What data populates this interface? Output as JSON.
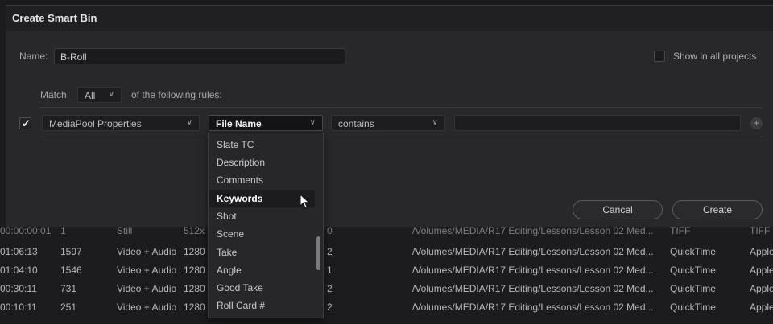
{
  "dialog": {
    "title": "Create Smart Bin",
    "name_label": "Name:",
    "name_value": "B-Roll",
    "show_all_label": "Show in all projects",
    "match_label": "Match",
    "match_value": "All",
    "match_suffix": "of the following rules:",
    "rule": {
      "property": "MediaPool Properties",
      "field": "File Name",
      "operator": "contains",
      "value": ""
    },
    "cancel_label": "Cancel",
    "create_label": "Create"
  },
  "dropdown": {
    "items": [
      "Slate TC",
      "Description",
      "Comments",
      "Keywords",
      "Shot",
      "Scene",
      "Take",
      "Angle",
      "Good Take",
      "Roll Card #"
    ],
    "highlighted": "Keywords"
  },
  "background_table": {
    "rows": [
      {
        "tc": "00:00:00:01",
        "frames": "1",
        "type": "Still",
        "res": "512x",
        "c5": "0",
        "path": "/Volumes/MEDIA/R17 Editing/Lessons/Lesson 02 Med...",
        "codec": "TIFF",
        "last": "TIFF"
      },
      {
        "tc": "01:06:13",
        "frames": "1597",
        "type": "Video + Audio",
        "res": "1280",
        "c5": "2",
        "path": "/Volumes/MEDIA/R17 Editing/Lessons/Lesson 02 Med...",
        "codec": "QuickTime",
        "last": "Apple"
      },
      {
        "tc": "01:04:10",
        "frames": "1546",
        "type": "Video + Audio",
        "res": "1280",
        "c5": "1",
        "path": "/Volumes/MEDIA/R17 Editing/Lessons/Lesson 02 Med...",
        "codec": "QuickTime",
        "last": "Apple"
      },
      {
        "tc": "00:30:11",
        "frames": "731",
        "type": "Video + Audio",
        "res": "1280",
        "c5": "2",
        "path": "/Volumes/MEDIA/R17 Editing/Lessons/Lesson 02 Med...",
        "codec": "QuickTime",
        "last": "Apple"
      },
      {
        "tc": "00:10:11",
        "frames": "251",
        "type": "Video + Audio",
        "res": "1280",
        "c5": "2",
        "path": "/Volumes/MEDIA/R17 Editing/Lessons/Lesson 02 Med...",
        "codec": "QuickTime",
        "last": "Apple"
      }
    ]
  },
  "colors": {
    "dialog_bg": "#28282a",
    "titlebar_bg": "#202022",
    "highlight_bg": "#1c1c1f"
  }
}
